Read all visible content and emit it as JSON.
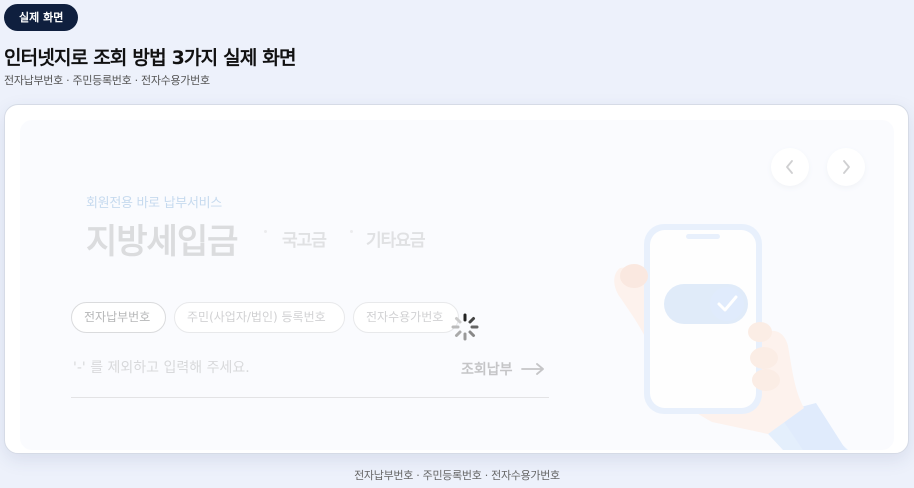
{
  "badge": "실제 화면",
  "header": {
    "title": "인터넷지로 조회 방법 3가지 실제 화면",
    "subtitle": "전자납부번호 · 주민등록번호 · 전자수용가번호"
  },
  "service": {
    "label": "회원전용 바로 납부서비스",
    "tabs": [
      "지방세입금",
      "국고금",
      "기타요금"
    ]
  },
  "options": [
    "전자납부번호",
    "주민(사업자/법인) 등록번호",
    "전자수용가번호"
  ],
  "input": {
    "placeholder": "'-' 를 제외하고 입력해 주세요.",
    "value": ""
  },
  "submit_label": "조회납부",
  "footer": "전자납부번호 · 주민등록번호 · 전자수용가번호",
  "icons": {
    "prev": "chevron-left-icon",
    "next": "chevron-right-icon",
    "submit": "arrow-right-icon",
    "loading": "spinner-icon",
    "illustration": "hand-holding-phone-with-toggle-check-icon"
  },
  "colors": {
    "badge_bg": "#0f1f3e",
    "accent_light_blue": "#a8c6e6",
    "page_bg": "#edf1fb"
  }
}
